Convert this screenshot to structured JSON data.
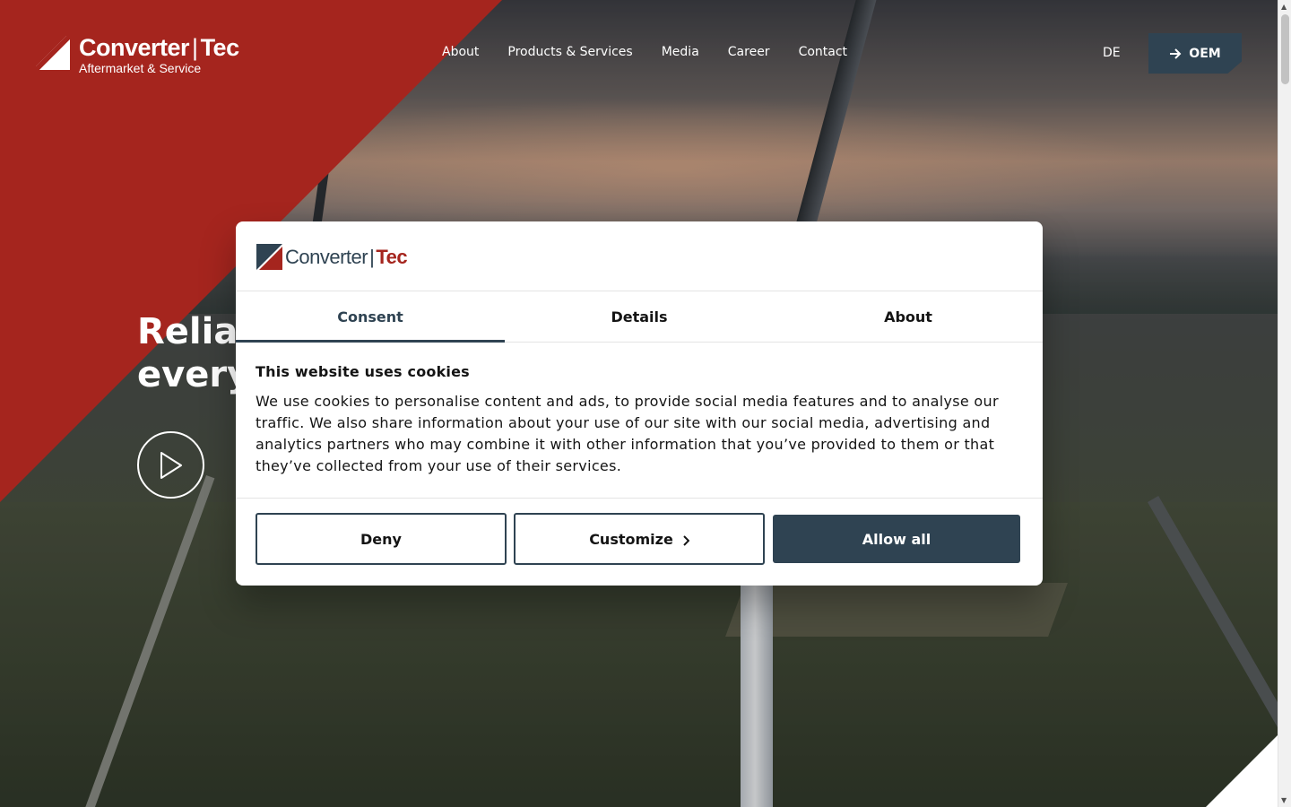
{
  "brand": {
    "name_main": "Converter",
    "name_divider": "|",
    "name_accent": "Tec",
    "tagline": "Aftermarket & Service",
    "colors": {
      "red": "#a5251e",
      "navy": "#2f4352"
    }
  },
  "nav": {
    "items": [
      "About",
      "Products & Services",
      "Media",
      "Career",
      "Contact"
    ],
    "language": "DE",
    "oem_label": "OEM"
  },
  "hero": {
    "title_line1": "Reliab",
    "title_line2": "every"
  },
  "cookie_dialog": {
    "tabs": [
      {
        "label": "Consent",
        "active": true
      },
      {
        "label": "Details",
        "active": false
      },
      {
        "label": "About",
        "active": false
      }
    ],
    "heading": "This website uses cookies",
    "body": "We use cookies to personalise content and ads, to provide social media features and to analyse our traffic. We also share information about your use of our site with our social media, advertising and analytics partners who may combine it with other information that you’ve provided to them or that they’ve collected from your use of their services.",
    "buttons": {
      "deny": "Deny",
      "customize": "Customize",
      "allow_all": "Allow all"
    }
  },
  "icons": {
    "oem": "arrow-right-icon",
    "play": "play-icon",
    "customize": "chevron-right-icon"
  }
}
